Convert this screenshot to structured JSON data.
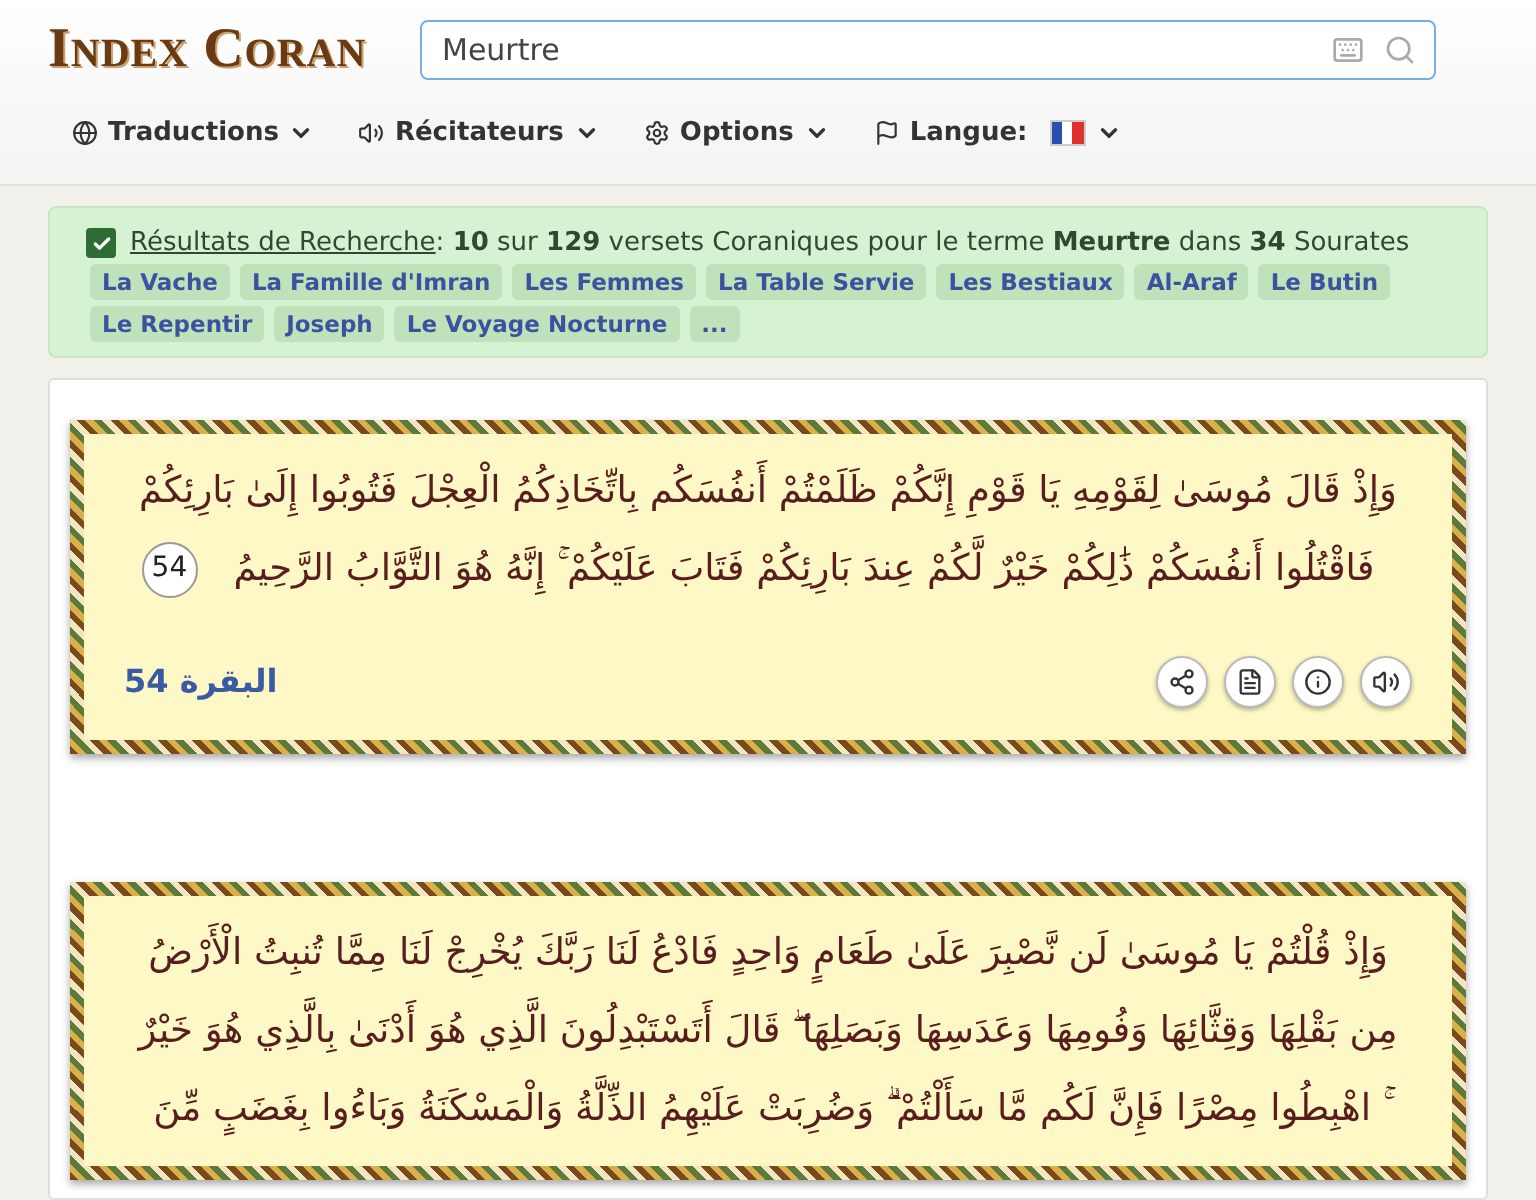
{
  "logo": {
    "text": "Index Coran"
  },
  "search": {
    "value": "Meurtre"
  },
  "nav": [
    {
      "label": "Traductions"
    },
    {
      "label": "Récitateurs"
    },
    {
      "label": "Options"
    },
    {
      "label": "Langue:"
    }
  ],
  "results": {
    "checked": true,
    "link": "Résultats de Recherche",
    "summary": ": **10** sur **129** versets Coraniques pour le terme **Meurtre** dans **34** Sourates",
    "tags": [
      "La Vache",
      "La Famille d'Imran",
      "Les Femmes",
      "La Table Servie",
      "Les Bestiaux",
      "Al-Araf",
      "Le Butin",
      "Le Repentir",
      "Joseph",
      "Le Voyage Nocturne",
      "..."
    ]
  },
  "verses": [
    {
      "lines": [
        "وَإِذْ قَالَ مُوسَىٰ لِقَوْمِهِ يَا قَوْمِ إِنَّكُمْ ظَلَمْتُمْ أَنفُسَكُم بِاتِّخَاذِكُمُ الْعِجْلَ فَتُوبُوا إِلَىٰ بَارِئِكُمْ",
        "فَاقْتُلُوا أَنفُسَكُمْ ذَٰلِكُمْ خَيْرٌ لَّكُمْ عِندَ بَارِئِكُمْ فَتَابَ عَلَيْكُمْ ۚ إِنَّهُ هُوَ التَّوَّابُ الرَّحِيمُ"
      ],
      "number": "54",
      "reference": "البقرة 54"
    },
    {
      "lines": [
        "وَإِذْ قُلْتُمْ يَا مُوسَىٰ لَن نَّصْبِرَ عَلَىٰ طَعَامٍ وَاحِدٍ فَادْعُ لَنَا رَبَّكَ يُخْرِجْ لَنَا مِمَّا تُنبِتُ الْأَرْضُ",
        "مِن بَقْلِهَا وَقِثَّائِهَا وَفُومِهَا وَعَدَسِهَا وَبَصَلِهَا ۖ قَالَ أَتَسْتَبْدِلُونَ الَّذِي هُوَ أَدْنَىٰ بِالَّذِي هُوَ خَيْرٌ",
        "ۚ اهْبِطُوا مِصْرًا فَإِنَّ لَكُم مَّا سَأَلْتُمْ ۗ وَضُرِبَتْ عَلَيْهِمُ الذِّلَّةُ وَالْمَسْكَنَةُ وَبَاءُوا بِغَضَبٍ مِّنَ"
      ]
    }
  ]
}
